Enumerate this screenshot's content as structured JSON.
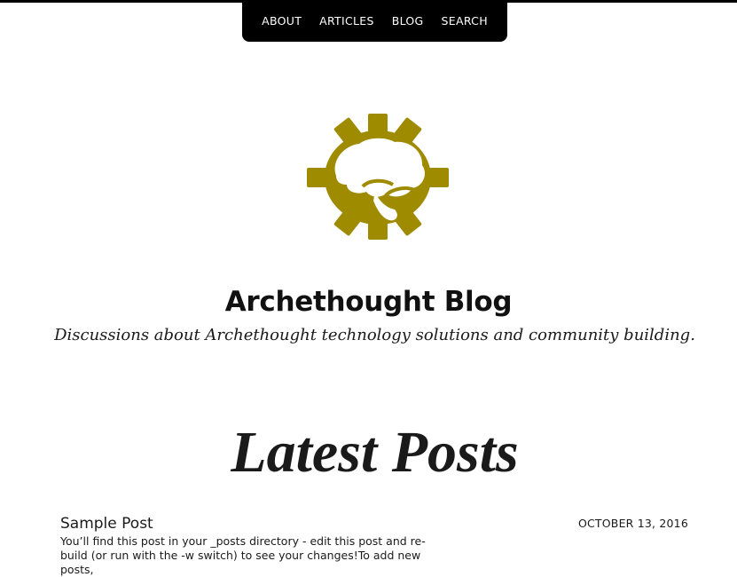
{
  "nav": {
    "items": [
      {
        "label": "ABOUT"
      },
      {
        "label": "ARTICLES"
      },
      {
        "label": "BLOG"
      },
      {
        "label": "SEARCH"
      }
    ]
  },
  "logo": {
    "icon": "gear-brain-logo-icon",
    "color": "#9e8b00"
  },
  "site": {
    "title": "Archethought Blog",
    "tagline": "Discussions about Archethought technology solutions and community building."
  },
  "latest": {
    "heading": "Latest Posts"
  },
  "posts": [
    {
      "title": "Sample Post",
      "date": "OCTOBER 13, 2016",
      "excerpt": "You’ll find this post in your _posts directory - edit this post and re-build (or run with the -w switch) to see your changes!To add new posts,"
    }
  ]
}
